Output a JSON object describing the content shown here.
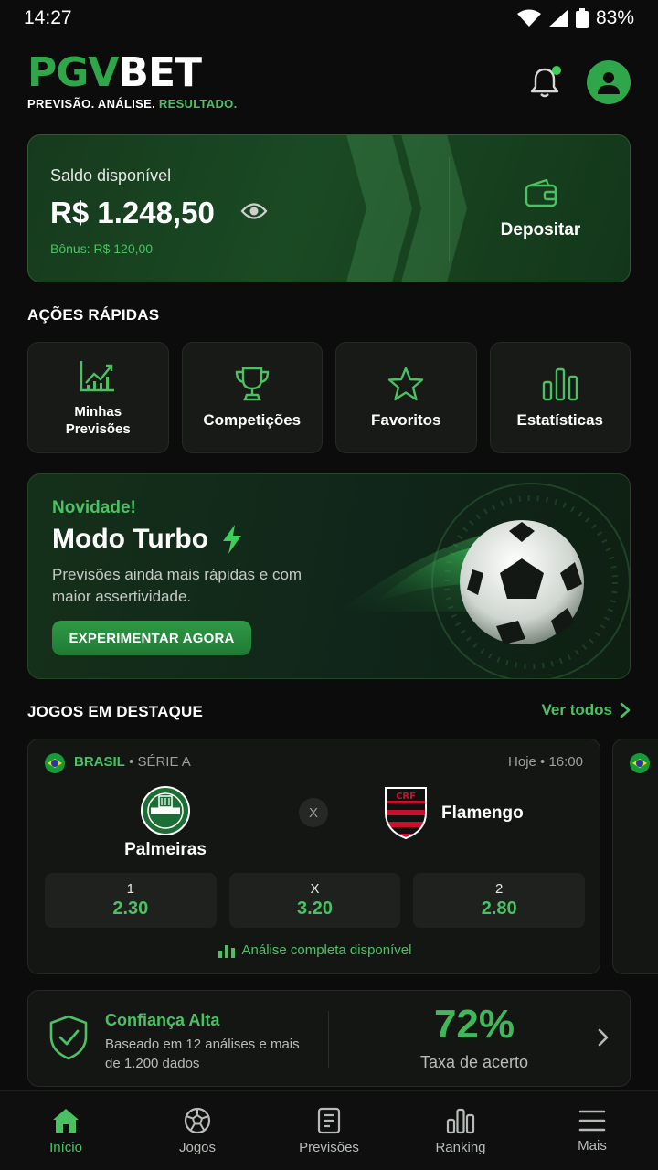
{
  "status_bar": {
    "time": "14:27",
    "battery": "83%"
  },
  "header": {
    "logo_part1": "PGV",
    "logo_part2": "BET",
    "tagline_part1": "PREVISÃO. ANÁLISE. ",
    "tagline_part2": "RESULTADO."
  },
  "balance": {
    "label": "Saldo disponível",
    "value": "R$ 1.248,50",
    "bonus": "Bônus: R$ 120,00",
    "deposit_label": "Depositar"
  },
  "quick_actions": {
    "title": "AÇÕES RÁPIDAS",
    "items": [
      {
        "label_line1": "Minhas",
        "label_line2": "Previsões",
        "icon": "chart-growth-icon"
      },
      {
        "label": "Competições",
        "icon": "trophy-icon"
      },
      {
        "label": "Favoritos",
        "icon": "star-icon"
      },
      {
        "label": "Estatísticas",
        "icon": "bar-chart-icon"
      }
    ]
  },
  "promo": {
    "kicker": "Novidade!",
    "title": "Modo Turbo",
    "description": "Previsões ainda mais rápidas e com maior assertividade.",
    "button": "EXPERIMENTAR AGORA"
  },
  "featured": {
    "title": "JOGOS EM DESTAQUE",
    "see_all": "Ver todos",
    "match": {
      "country": "BRASIL",
      "separator": " • ",
      "league": "SÉRIE A",
      "time": "Hoje • 16:00",
      "home": "Palmeiras",
      "away": "Flamengo",
      "vs": "X",
      "odds": [
        {
          "label": "1",
          "value": "2.30"
        },
        {
          "label": "X",
          "value": "3.20"
        },
        {
          "label": "2",
          "value": "2.80"
        }
      ],
      "analysis": "Análise completa disponível"
    }
  },
  "confidence": {
    "title": "Confiança Alta",
    "description": "Baseado em 12 análises e mais de 1.200 dados",
    "percent": "72%",
    "rate_label": "Taxa de acerto"
  },
  "bottom_nav": [
    {
      "label": "Início",
      "active": true
    },
    {
      "label": "Jogos"
    },
    {
      "label": "Previsões"
    },
    {
      "label": "Ranking"
    },
    {
      "label": "Mais"
    }
  ],
  "colors": {
    "accent": "#4bc163",
    "brand": "#2fa64a",
    "background": "#0b0c0b"
  }
}
